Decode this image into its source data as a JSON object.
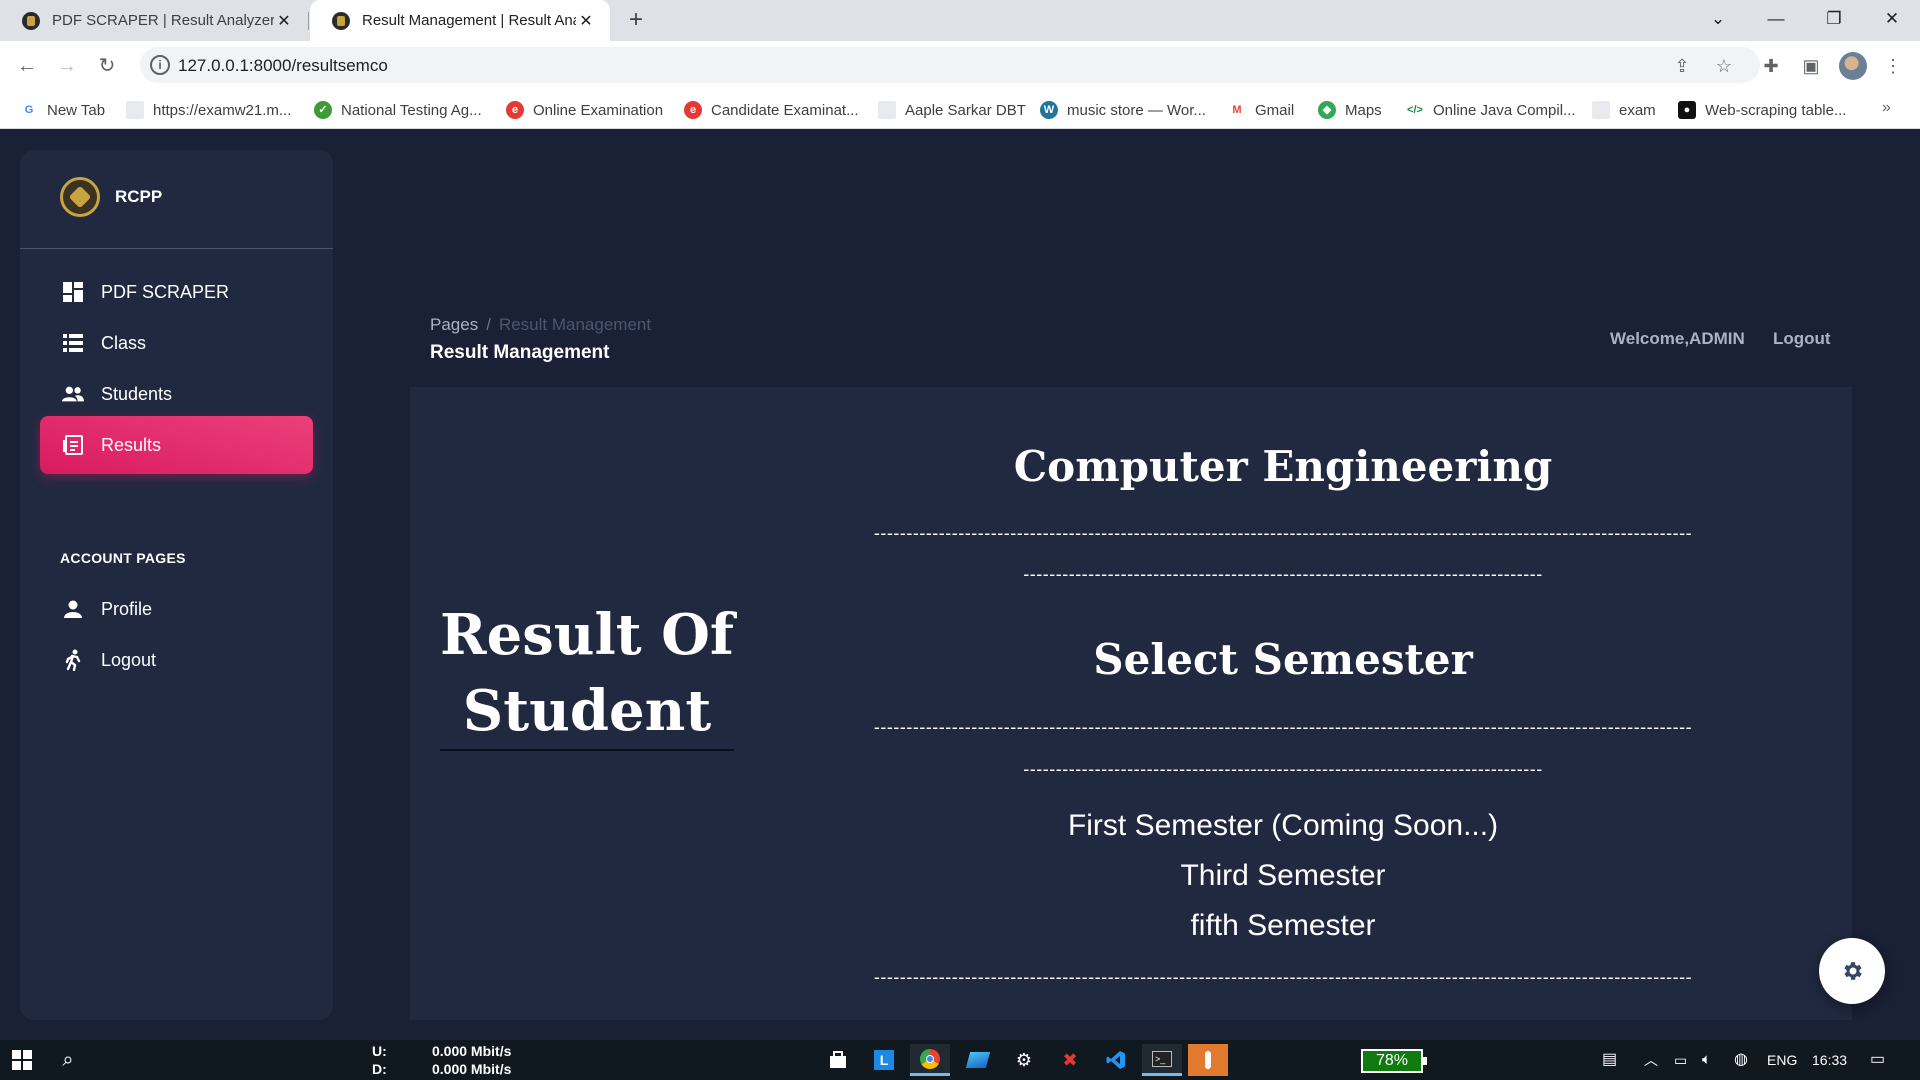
{
  "browser": {
    "tabs": [
      {
        "title": "PDF SCRAPER | Result Analyzer S",
        "active": false
      },
      {
        "title": "Result Management | Result Anal",
        "active": true
      }
    ],
    "url": "127.0.0.1:8000/resultsemco",
    "bookmarks": [
      {
        "label": "New Tab",
        "icon": "google-icon",
        "color": "#4285f4"
      },
      {
        "label": "https://examw21.m...",
        "icon": "page-icon",
        "color": "#8ab4f8"
      },
      {
        "label": "National Testing Ag...",
        "icon": "nta-icon",
        "color": "#3f9c35"
      },
      {
        "label": "Online Examination",
        "icon": "exam-icon",
        "color": "#e53935"
      },
      {
        "label": "Candidate Examinat...",
        "icon": "exam-icon",
        "color": "#e53935"
      },
      {
        "label": "Aaple Sarkar DBT",
        "icon": "page-icon",
        "color": "#8ab4f8"
      },
      {
        "label": "music store — Wor...",
        "icon": "wordpress-icon",
        "color": "#21759b"
      },
      {
        "label": "Gmail",
        "icon": "gmail-icon",
        "color": "#ea4335"
      },
      {
        "label": "Maps",
        "icon": "maps-icon",
        "color": "#34a853"
      },
      {
        "label": "Online Java Compil...",
        "icon": "code-icon",
        "color": "#1b8a3e"
      },
      {
        "label": "exam",
        "icon": "page-icon",
        "color": "#8ab4f8"
      },
      {
        "label": "Web-scraping table...",
        "icon": "medium-icon",
        "color": "#111111"
      }
    ]
  },
  "sidebar": {
    "brand": "RCPP",
    "items": [
      {
        "label": "PDF SCRAPER",
        "icon": "dashboard-icon"
      },
      {
        "label": "Class",
        "icon": "table-icon"
      },
      {
        "label": "Students",
        "icon": "users-icon"
      },
      {
        "label": "Results",
        "icon": "receipt-icon",
        "active": true
      }
    ],
    "section_label": "ACCOUNT PAGES",
    "account_items": [
      {
        "label": "Profile",
        "icon": "person-icon"
      },
      {
        "label": "Logout",
        "icon": "run-icon"
      }
    ]
  },
  "header": {
    "breadcrumb_root": "Pages",
    "breadcrumb_sep": "/",
    "breadcrumb_current": "Result Management",
    "title": "Result Management",
    "welcome": "Welcome,ADMIN",
    "logout": "Logout"
  },
  "main": {
    "left_title_line1": "Result Of",
    "left_title_line2": "Student",
    "department": "Computer Engineering",
    "dash_long": "------------------------------------------------------------------------------------------------------------------------------",
    "dash_short": "--------------------------------------------------------------------------------",
    "select_heading": "Select Semester",
    "semesters": [
      "First Semester (Coming Soon...)",
      "Third Semester",
      "fifth Semester"
    ]
  },
  "taskbar": {
    "net_up_label": "U:",
    "net_up": "0.000 Mbit/s",
    "net_down_label": "D:",
    "net_down": "0.000 Mbit/s",
    "battery": "78%",
    "lang": "ENG",
    "time": "16:33"
  },
  "colors": {
    "background": "#1a2035",
    "card": "#202940",
    "accent": "#e91e63"
  }
}
